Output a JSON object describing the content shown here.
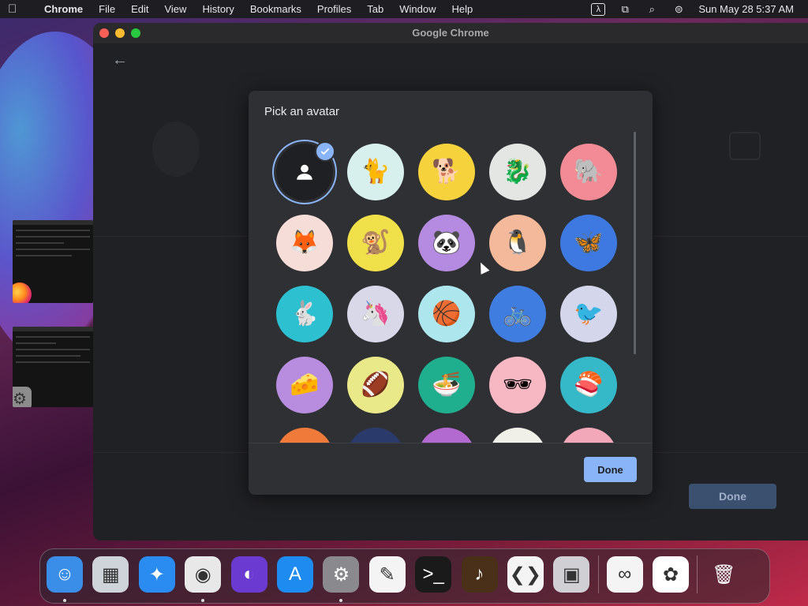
{
  "menubar": {
    "app_name": "Chrome",
    "menus": [
      "File",
      "Edit",
      "View",
      "History",
      "Bookmarks",
      "Profiles",
      "Tab",
      "Window",
      "Help"
    ],
    "clock": "Sun May 28  5:37 AM"
  },
  "window": {
    "title": "Google Chrome",
    "background_done_label": "Done"
  },
  "dialog": {
    "title": "Pick an avatar",
    "done_label": "Done",
    "selected_index": 0,
    "avatars": [
      {
        "name": "generic-person",
        "bg": "#1f2023",
        "glyph": ""
      },
      {
        "name": "cat",
        "bg": "#d7f0ee",
        "glyph": "🐈"
      },
      {
        "name": "corgi",
        "bg": "#f6d33c",
        "glyph": "🐕"
      },
      {
        "name": "dragon",
        "bg": "#e4e6e3",
        "glyph": "🐉"
      },
      {
        "name": "elephant",
        "bg": "#f28b95",
        "glyph": "🐘"
      },
      {
        "name": "fox",
        "bg": "#f7ddd8",
        "glyph": "🦊"
      },
      {
        "name": "monkey",
        "bg": "#f0e04a",
        "glyph": "🐒"
      },
      {
        "name": "panda",
        "bg": "#b48be0",
        "glyph": "🐼"
      },
      {
        "name": "penguin",
        "bg": "#f4b89a",
        "glyph": "🐧"
      },
      {
        "name": "butterfly",
        "bg": "#3d79e0",
        "glyph": "🦋"
      },
      {
        "name": "rabbit",
        "bg": "#2cc0d0",
        "glyph": "🐇"
      },
      {
        "name": "unicorn",
        "bg": "#d8d8e8",
        "glyph": "🦄"
      },
      {
        "name": "basketball",
        "bg": "#aee6ee",
        "glyph": "🏀"
      },
      {
        "name": "bicycle",
        "bg": "#3f7de0",
        "glyph": "🚲"
      },
      {
        "name": "bird",
        "bg": "#d4d6ec",
        "glyph": "🐦"
      },
      {
        "name": "cheese",
        "bg": "#b88de0",
        "glyph": "🧀"
      },
      {
        "name": "football",
        "bg": "#e9e98a",
        "glyph": "🏈"
      },
      {
        "name": "ramen",
        "bg": "#1fae8e",
        "glyph": "🍜"
      },
      {
        "name": "sunglasses",
        "bg": "#f7b8c4",
        "glyph": "🕶"
      },
      {
        "name": "sushi",
        "bg": "#35b8c8",
        "glyph": "🍣"
      },
      {
        "name": "row6-1",
        "bg": "#f07a3a",
        "glyph": ""
      },
      {
        "name": "row6-2",
        "bg": "#2a3a6a",
        "glyph": ""
      },
      {
        "name": "row6-3",
        "bg": "#b36ad0",
        "glyph": ""
      },
      {
        "name": "row6-4",
        "bg": "#f0efe8",
        "glyph": ""
      },
      {
        "name": "row6-5",
        "bg": "#f2a8b8",
        "glyph": ""
      }
    ]
  },
  "dock": {
    "apps": [
      {
        "name": "finder",
        "bg": "#3b8ee8",
        "glyph": "☺",
        "running": true
      },
      {
        "name": "launchpad",
        "bg": "#cfd3da",
        "glyph": "▦",
        "running": false
      },
      {
        "name": "safari",
        "bg": "#2a8cf0",
        "glyph": "✦",
        "running": false
      },
      {
        "name": "chrome",
        "bg": "#e8e8e8",
        "glyph": "◉",
        "running": true
      },
      {
        "name": "firefox",
        "bg": "#6b3ad0",
        "glyph": "◐",
        "running": false
      },
      {
        "name": "app-store",
        "bg": "#1d8bf0",
        "glyph": "A",
        "running": false
      },
      {
        "name": "system-preferences",
        "bg": "#8a8a8e",
        "glyph": "⚙",
        "running": true
      },
      {
        "name": "textedit",
        "bg": "#f4f4f4",
        "glyph": "✎",
        "running": false
      },
      {
        "name": "terminal",
        "bg": "#1a1a1a",
        "glyph": ">_",
        "running": false
      },
      {
        "name": "garageband",
        "bg": "#4a3018",
        "glyph": "♪",
        "running": false
      },
      {
        "name": "vscode",
        "bg": "#f4f4f4",
        "glyph": "❮❯",
        "running": false
      },
      {
        "name": "archive-utility",
        "bg": "#d0d0d4",
        "glyph": "▣",
        "running": false
      },
      {
        "name": "visual-studio",
        "bg": "#f4f4f4",
        "glyph": "∞",
        "running": false
      },
      {
        "name": "photos",
        "bg": "#ffffff",
        "glyph": "✿",
        "running": false
      },
      {
        "name": "trash",
        "bg": "transparent",
        "glyph": "🗑",
        "running": false
      }
    ]
  },
  "colors": {
    "accent": "#8ab4f8",
    "dialog_bg": "#2f3033",
    "window_bg": "#202124"
  }
}
